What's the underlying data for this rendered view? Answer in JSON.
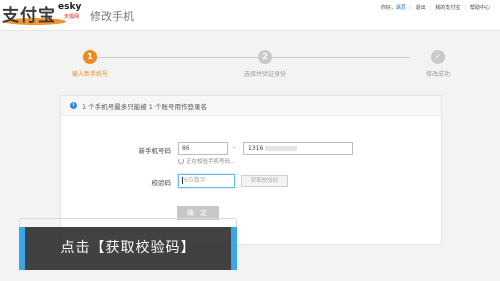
{
  "header": {
    "logo_main": "支付宝",
    "logo_sub": "esky",
    "logo_sub2": "天极网",
    "page_title": "修改手机",
    "links": {
      "greeting": "你好，",
      "user": "飒荔",
      "logout": "退出",
      "my_alipay": "我的支付宝",
      "help": "帮助中心"
    }
  },
  "steps": [
    {
      "number": "1",
      "label": "输入新手机号",
      "state": "active"
    },
    {
      "number": "2",
      "label": "选择并验证身份",
      "state": "pending"
    },
    {
      "number": "✓",
      "label": "修改成功",
      "state": "done"
    }
  ],
  "notice": {
    "icon": "info-icon",
    "text": "1 个手机号最多只能被 1 个账号用作登录名"
  },
  "form": {
    "phone_label": "新手机号码",
    "country_code": "86",
    "dash": "-",
    "phone_value": "1316",
    "checking_text": "正在校验手机号码...",
    "code_label": "校验码",
    "code_placeholder": "6位数字",
    "get_code_label": "获取校验码",
    "submit_label": "确 定"
  },
  "caption": {
    "text": "点击【获取校验码】"
  },
  "colors": {
    "accent": "#f08a1c",
    "link": "#1d6fb8",
    "caption_accent": "#38a8ea"
  }
}
